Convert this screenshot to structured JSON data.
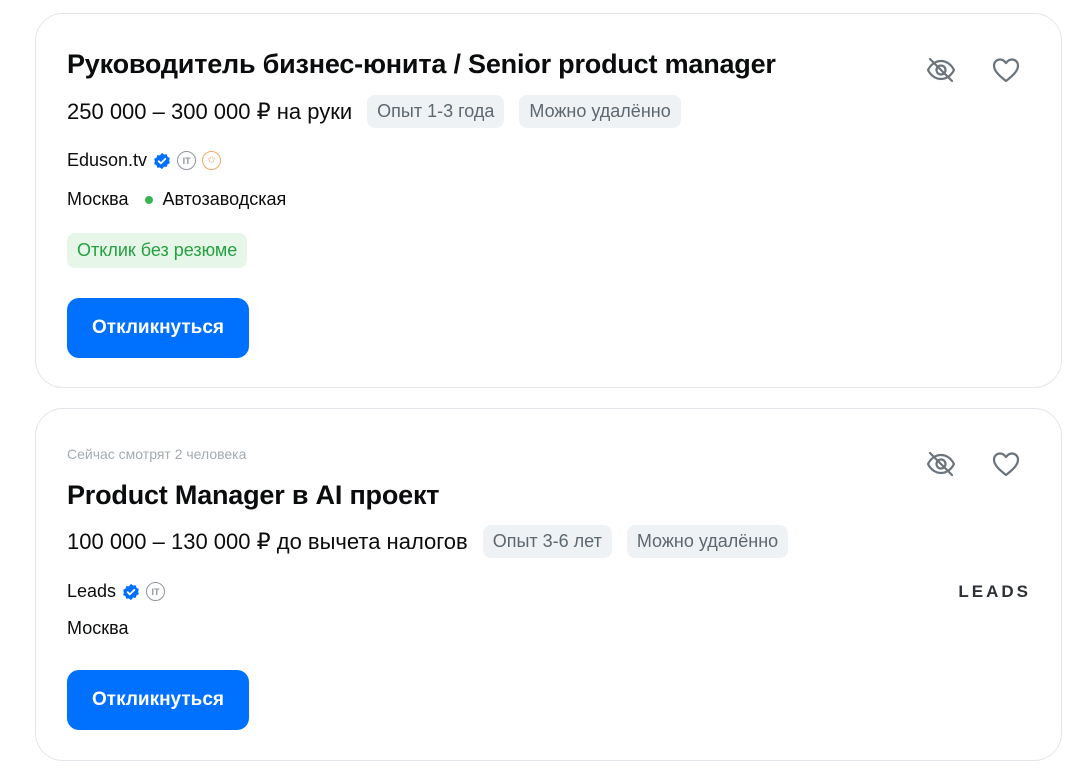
{
  "vacancies": [
    {
      "title": "Руководитель бизнес-юнита / Senior product manager",
      "salary": "250 000 – 300 000 ₽ на руки",
      "experience": "Опыт 1-3 года",
      "remote": "Можно удалённо",
      "company": "Eduson.tv",
      "company_badges": [
        "verified-icon",
        "it-accredited-icon",
        "award-icon"
      ],
      "it_badge_text": "IT",
      "city": "Москва",
      "metro": "Автозаводская",
      "metro_color": "#36b553",
      "no_resume_label": "Отклик без резюме",
      "respond_label": "Откликнуться"
    },
    {
      "viewers": "Сейчас смотрят 2 человека",
      "title": "Product Manager в AI проект",
      "salary": "100 000 – 130 000 ₽ до вычета налогов",
      "experience": "Опыт 3-6 лет",
      "remote": "Можно удалённо",
      "company": "Leads",
      "company_badges": [
        "verified-icon",
        "it-accredited-icon"
      ],
      "it_badge_text": "IT",
      "logo_text": "LEADS",
      "city": "Москва",
      "respond_label": "Откликнуться"
    }
  ],
  "colors": {
    "accent": "#0070ff",
    "green_chip_bg": "#e6f6e9",
    "green_chip_text": "#26a041",
    "chip_bg": "#eff2f5",
    "icon_gray": "#6b747c"
  },
  "icons": {
    "hide": "eye-off-icon",
    "favorite": "heart-icon"
  }
}
